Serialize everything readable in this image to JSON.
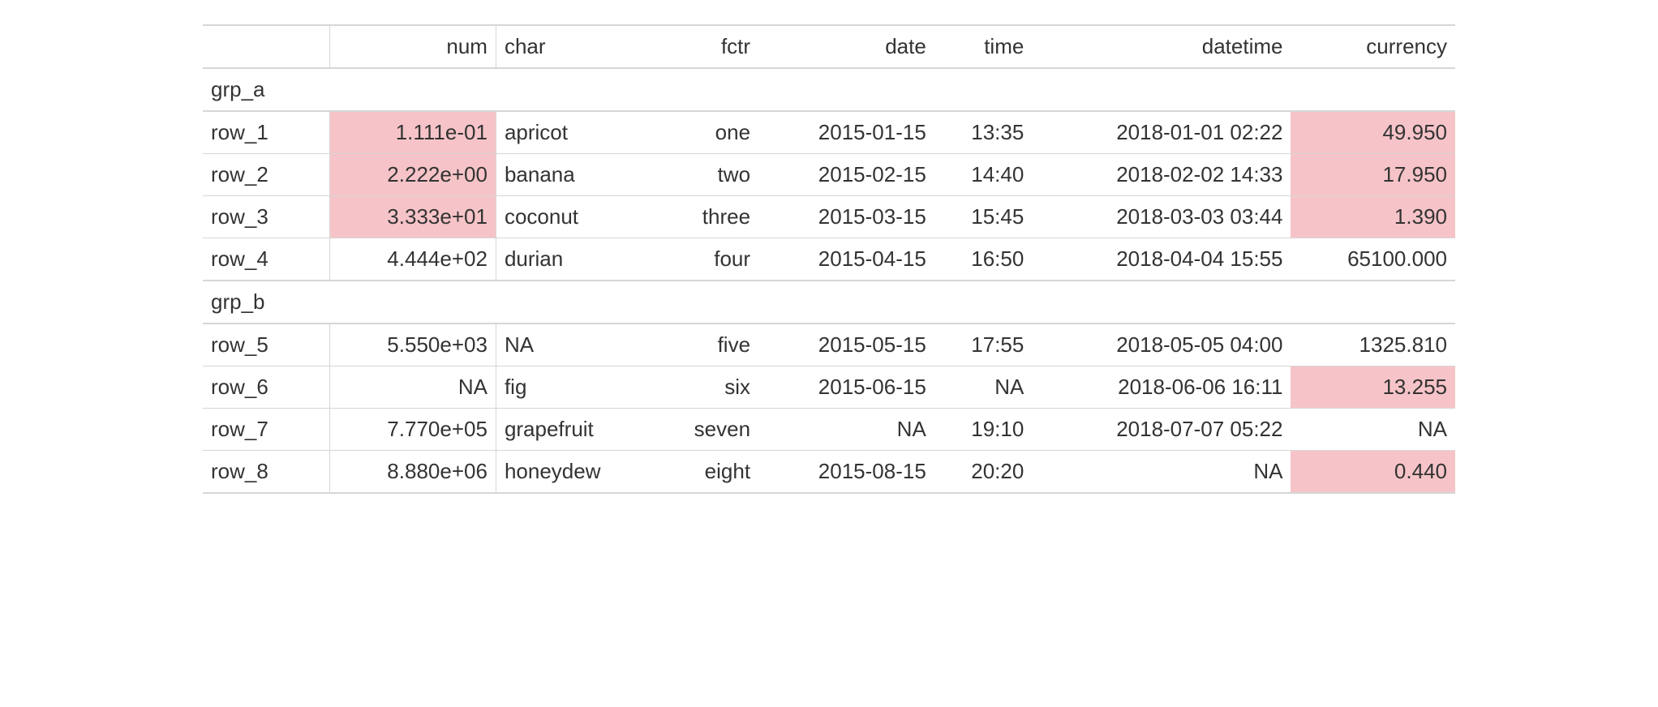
{
  "columns": {
    "stub": "",
    "num": "num",
    "char": "char",
    "fctr": "fctr",
    "date": "date",
    "time": "time",
    "datetime": "datetime",
    "currency": "currency"
  },
  "groups": [
    {
      "label": "grp_a",
      "rows": [
        {
          "stub": "row_1",
          "num": {
            "value": "1.111e-01",
            "highlight": true
          },
          "char": "apricot",
          "fctr": "one",
          "date": "2015-01-15",
          "time": "13:35",
          "datetime": "2018-01-01 02:22",
          "currency": {
            "value": "49.950",
            "highlight": true
          }
        },
        {
          "stub": "row_2",
          "num": {
            "value": "2.222e+00",
            "highlight": true
          },
          "char": "banana",
          "fctr": "two",
          "date": "2015-02-15",
          "time": "14:40",
          "datetime": "2018-02-02 14:33",
          "currency": {
            "value": "17.950",
            "highlight": true
          }
        },
        {
          "stub": "row_3",
          "num": {
            "value": "3.333e+01",
            "highlight": true
          },
          "char": "coconut",
          "fctr": "three",
          "date": "2015-03-15",
          "time": "15:45",
          "datetime": "2018-03-03 03:44",
          "currency": {
            "value": "1.390",
            "highlight": true
          }
        },
        {
          "stub": "row_4",
          "num": {
            "value": "4.444e+02",
            "highlight": false
          },
          "char": "durian",
          "fctr": "four",
          "date": "2015-04-15",
          "time": "16:50",
          "datetime": "2018-04-04 15:55",
          "currency": {
            "value": "65100.000",
            "highlight": false
          }
        }
      ]
    },
    {
      "label": "grp_b",
      "rows": [
        {
          "stub": "row_5",
          "num": {
            "value": "5.550e+03",
            "highlight": false
          },
          "char": "NA",
          "fctr": "five",
          "date": "2015-05-15",
          "time": "17:55",
          "datetime": "2018-05-05 04:00",
          "currency": {
            "value": "1325.810",
            "highlight": false
          }
        },
        {
          "stub": "row_6",
          "num": {
            "value": "NA",
            "highlight": false
          },
          "char": "fig",
          "fctr": "six",
          "date": "2015-06-15",
          "time": "NA",
          "datetime": "2018-06-06 16:11",
          "currency": {
            "value": "13.255",
            "highlight": true
          }
        },
        {
          "stub": "row_7",
          "num": {
            "value": "7.770e+05",
            "highlight": false
          },
          "char": "grapefruit",
          "fctr": "seven",
          "date": "NA",
          "time": "19:10",
          "datetime": "2018-07-07 05:22",
          "currency": {
            "value": "NA",
            "highlight": false
          }
        },
        {
          "stub": "row_8",
          "num": {
            "value": "8.880e+06",
            "highlight": false
          },
          "char": "honeydew",
          "fctr": "eight",
          "date": "2015-08-15",
          "time": "20:20",
          "datetime": "NA",
          "currency": {
            "value": "0.440",
            "highlight": true
          }
        }
      ]
    }
  ]
}
